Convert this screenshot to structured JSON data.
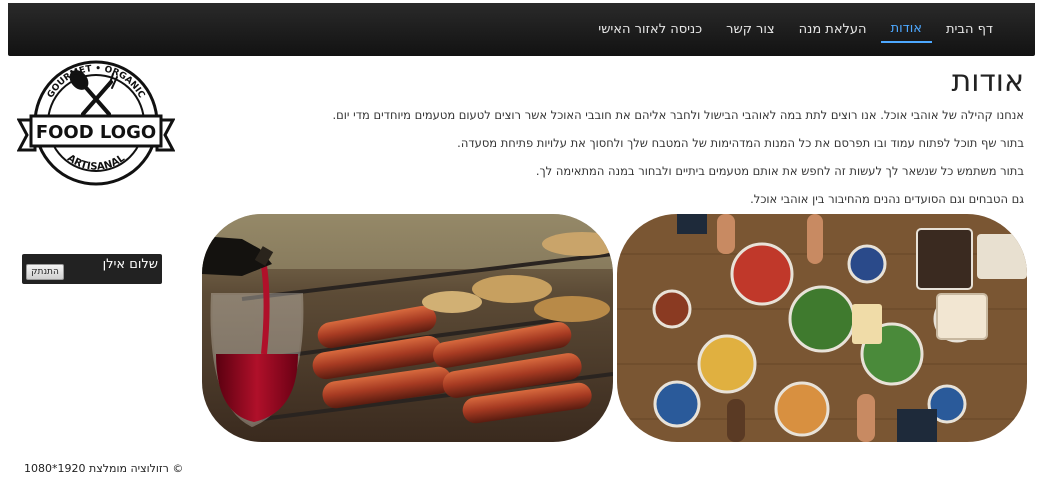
{
  "nav": {
    "items": [
      {
        "label": "דף הבית",
        "active": false
      },
      {
        "label": "אודות",
        "active": true
      },
      {
        "label": "העלאת מנה",
        "active": false
      },
      {
        "label": "צור קשר",
        "active": false
      },
      {
        "label": "כניסה לאזור האישי",
        "active": false
      }
    ]
  },
  "page": {
    "title": "אודות",
    "paragraphs": [
      "אנחנו קהילה של אוהבי אוכל. אנו רוצים לתת במה לאוהבי הבישול ולחבר אליהם את חובבי האוכל אשר רוצים לטעום מטעמים מיוחדים מדי יום.",
      "בתור שף תוכל לפתוח עמוד ובו תפרסם את כל המנות המדהימות של המטבח שלך ולחסוך את עלויות פתיחת מסעדה.",
      "בתור משתמש כל שנשאר לך לעשות זה לחפש את אותם מטעמים ביתיים ולבחור במנה המתאימה לך.",
      "גם הטבחים וגם הסועדים נהנים מהחיבור בין אוהבי אוכל."
    ]
  },
  "logo": {
    "top_text": "GOURMET • ORGANIC",
    "main_text": "FOOD LOGO",
    "bottom_text": "ARTISANAL"
  },
  "user": {
    "greeting": "שלום אילן",
    "logout_label": "התנתק"
  },
  "footer": {
    "text": "© רזולוציה מומלצת 1920*1080"
  },
  "colors": {
    "nav_bg": "#1b1b1b",
    "nav_active": "#4da8ff",
    "greet_bg": "#222222"
  }
}
